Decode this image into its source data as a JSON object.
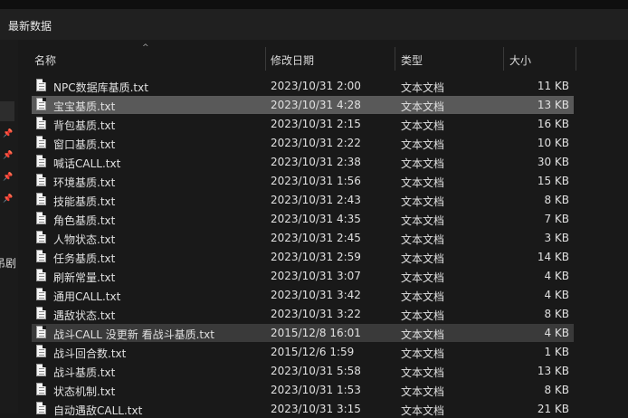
{
  "window": {
    "title": "最新数据"
  },
  "headers": {
    "name": "名称",
    "date": "修改日期",
    "type": "类型",
    "size": "大小",
    "sort_indicator": "^"
  },
  "nav": {
    "fragment": "吊剧"
  },
  "files": [
    {
      "name": "NPC数据库基质.txt",
      "date": "2023/10/31 2:00",
      "type": "文本文档",
      "size": "11 KB"
    },
    {
      "name": "宝宝基质.txt",
      "date": "2023/10/31 4:28",
      "type": "文本文档",
      "size": "13 KB"
    },
    {
      "name": "背包基质.txt",
      "date": "2023/10/31 2:15",
      "type": "文本文档",
      "size": "16 KB"
    },
    {
      "name": "窗口基质.txt",
      "date": "2023/10/31 2:22",
      "type": "文本文档",
      "size": "10 KB"
    },
    {
      "name": "喊话CALL.txt",
      "date": "2023/10/31 2:38",
      "type": "文本文档",
      "size": "30 KB"
    },
    {
      "name": "环境基质.txt",
      "date": "2023/10/31 1:56",
      "type": "文本文档",
      "size": "15 KB"
    },
    {
      "name": "技能基质.txt",
      "date": "2023/10/31 2:43",
      "type": "文本文档",
      "size": "8 KB"
    },
    {
      "name": "角色基质.txt",
      "date": "2023/10/31 4:35",
      "type": "文本文档",
      "size": "7 KB"
    },
    {
      "name": "人物状态.txt",
      "date": "2023/10/31 2:45",
      "type": "文本文档",
      "size": "3 KB"
    },
    {
      "name": "任务基质.txt",
      "date": "2023/10/31 2:59",
      "type": "文本文档",
      "size": "14 KB"
    },
    {
      "name": "刷新常量.txt",
      "date": "2023/10/31 3:07",
      "type": "文本文档",
      "size": "4 KB"
    },
    {
      "name": "通用CALL.txt",
      "date": "2023/10/31 3:42",
      "type": "文本文档",
      "size": "4 KB"
    },
    {
      "name": "遇敌状态.txt",
      "date": "2023/10/31 3:22",
      "type": "文本文档",
      "size": "8 KB"
    },
    {
      "name": "战斗CALL 没更新 看战斗基质.txt",
      "date": "2015/12/8 16:01",
      "type": "文本文档",
      "size": "4 KB"
    },
    {
      "name": "战斗回合数.txt",
      "date": "2015/12/6 1:59",
      "type": "文本文档",
      "size": "1 KB"
    },
    {
      "name": "战斗基质.txt",
      "date": "2023/10/31 5:58",
      "type": "文本文档",
      "size": "13 KB"
    },
    {
      "name": "状态机制.txt",
      "date": "2023/10/31 1:53",
      "type": "文本文档",
      "size": "8 KB"
    },
    {
      "name": "自动遇敌CALL.txt",
      "date": "2023/10/31 3:15",
      "type": "文本文档",
      "size": "21 KB"
    }
  ]
}
